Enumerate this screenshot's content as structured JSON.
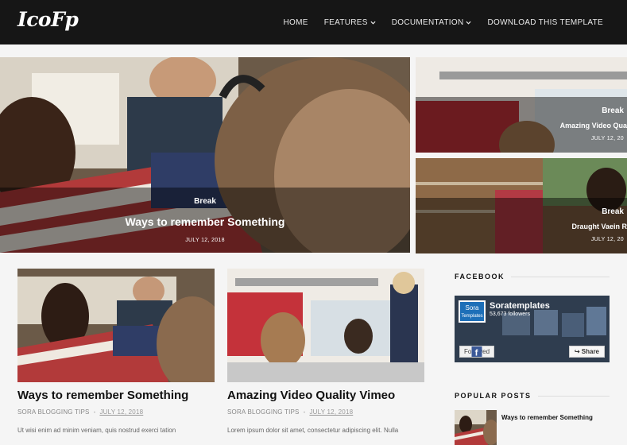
{
  "header": {
    "logo": "IcoFp",
    "nav": [
      {
        "label": "HOME",
        "dropdown": false
      },
      {
        "label": "FEATURES",
        "dropdown": true
      },
      {
        "label": "DOCUMENTATION",
        "dropdown": true
      },
      {
        "label": "DOWNLOAD THIS TEMPLATE",
        "dropdown": false
      }
    ]
  },
  "slider": {
    "main": {
      "category": "Break",
      "title": "Ways to remember Something",
      "date": "JULY 12, 2018"
    },
    "side_a": {
      "category": "Break",
      "title": "Amazing Video Qua",
      "date": "JULY 12, 20"
    },
    "side_b": {
      "category": "Break",
      "title": "Draught Vaein R",
      "date": "JULY 12, 20"
    }
  },
  "posts": [
    {
      "title": "Ways to remember Something",
      "author": "SORA BLOGGING TIPS",
      "date": "JULY 12, 2018",
      "excerpt": "Ut wisi enim ad minim veniam, quis nostrud exerci tation"
    },
    {
      "title": "Amazing Video Quality Vimeo",
      "author": "SORA BLOGGING TIPS",
      "date": "JULY 12, 2018",
      "excerpt": "Lorem ipsum dolor sit amet, consectetur adipiscing elit. Nulla"
    }
  ],
  "sidebar": {
    "facebook_title": "FACEBOOK",
    "facebook": {
      "logo_text_1": "Sora",
      "logo_text_2": "Templates",
      "page_name": "Soratemplates",
      "followers": "53,673 followers",
      "followed_label": "Followed",
      "share_label": "Share"
    },
    "popular_title": "POPULAR POSTS",
    "popular": [
      {
        "title": "Ways to remember Something"
      }
    ]
  },
  "colors": {
    "topbar": "#161616",
    "background": "#f5f5f5",
    "facebook_blue": "#1d6fb8"
  }
}
